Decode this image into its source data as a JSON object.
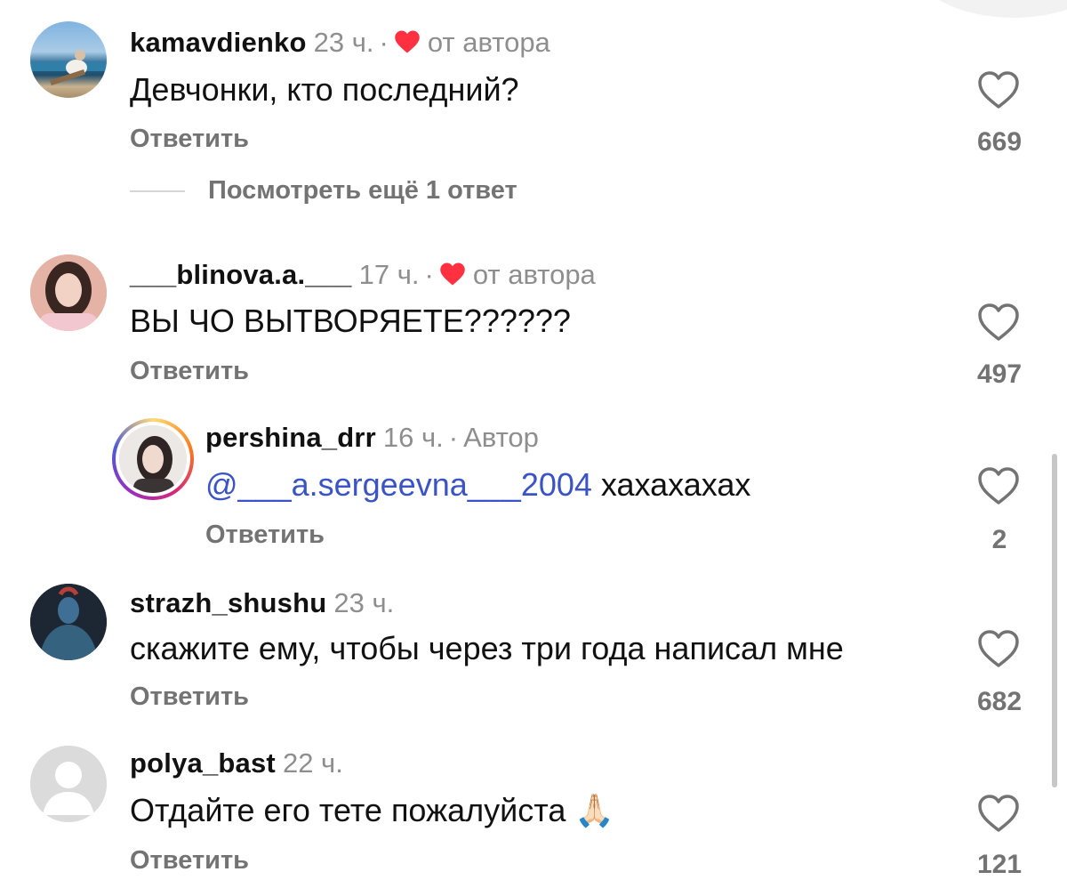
{
  "comments": [
    {
      "username": "kamavdienko",
      "time": "23 ч.",
      "author_like": true,
      "author_label": "от автора",
      "text": "Девчонки, кто последний?",
      "reply_label": "Ответить",
      "likes": "669"
    },
    {
      "username": "___blinova.a.___",
      "time": "17 ч.",
      "author_like": true,
      "author_label": "от автора",
      "text": "ВЫ ЧО ВЫТВОРЯЕТЕ??????",
      "reply_label": "Ответить",
      "likes": "497"
    },
    {
      "username": "pershina_drr",
      "time": "16 ч.",
      "badge": "Автор",
      "mention": "@___a.sergeevna___2004",
      "text": "хахахахах",
      "reply_label": "Ответить",
      "likes": "2",
      "is_reply": true
    },
    {
      "username": "strazh_shushu",
      "time": "23 ч.",
      "text": "скажите ему, чтобы через три года написал мне",
      "reply_label": "Ответить",
      "likes": "682"
    },
    {
      "username": "polya_bast",
      "time": "22 ч.",
      "text": "Отдайте его тете пожалуйста",
      "emoji": "🙏🏻",
      "reply_label": "Ответить",
      "likes": "121"
    }
  ],
  "view_more_replies": "Посмотреть ещё 1 ответ",
  "colors": {
    "heart_red": "#ff3040",
    "mention_blue": "#3a53c5",
    "secondary_text": "#737373"
  }
}
